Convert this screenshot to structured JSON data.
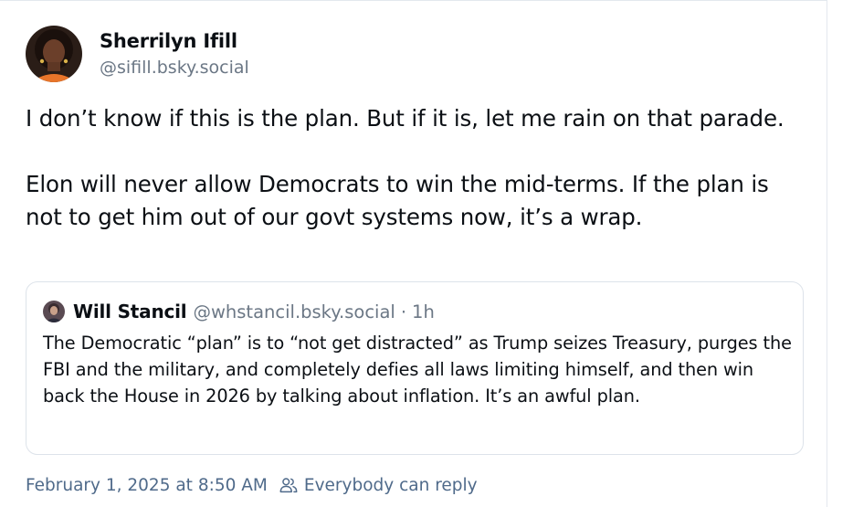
{
  "post": {
    "author": {
      "display_name": "Sherrilyn Ifill",
      "handle": "@sifill.bsky.social"
    },
    "paragraphs": [
      "I don’t know if this is the plan. But if it is, let me rain on that parade.",
      "Elon will never allow Democrats to win the mid-terms. If the plan is not to get him out of our govt systems now, it’s a wrap."
    ],
    "timestamp": "February 1, 2025 at 8:50 AM",
    "reply_setting": "Everybody can reply"
  },
  "quote": {
    "display_name": "Will Stancil",
    "handle": "@whstancil.bsky.social",
    "separator": "·",
    "time": "1h",
    "text": "The Democratic “plan” is to “not get distracted” as Trump seizes Treasury, purges the FBI and the military, and completely defies all laws limiting himself, and then win back the House in 2026 by talking about inflation. It’s an awful plan."
  },
  "icons": {
    "author_avatar": "avatar-photo",
    "quote_avatar": "avatar-photo",
    "reply_icon": "people-icon"
  },
  "colors": {
    "text": "#0b0f14",
    "muted": "#6b7785",
    "footer": "#4f6a8a",
    "border": "#dde3ea"
  }
}
